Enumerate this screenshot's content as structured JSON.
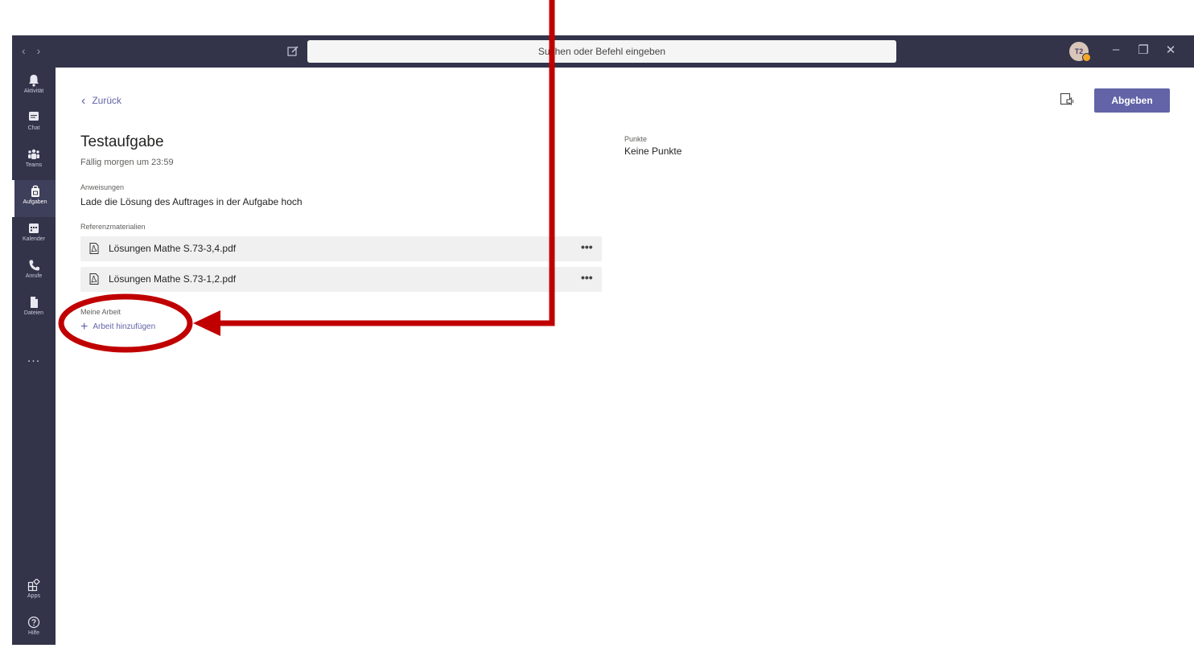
{
  "titlebar": {
    "search_placeholder": "Suchen oder Befehl eingeben",
    "avatar_initials": "T2"
  },
  "sidebar": {
    "items": [
      {
        "label": "Aktivität",
        "icon": "bell-icon"
      },
      {
        "label": "Chat",
        "icon": "chat-icon"
      },
      {
        "label": "Teams",
        "icon": "teams-icon"
      },
      {
        "label": "Aufgaben",
        "icon": "assignments-icon"
      },
      {
        "label": "Kalender",
        "icon": "calendar-icon"
      },
      {
        "label": "Anrufe",
        "icon": "phone-icon"
      },
      {
        "label": "Dateien",
        "icon": "files-icon"
      }
    ],
    "active": "Aufgaben",
    "more": "...",
    "bottom": [
      {
        "label": "Apps",
        "icon": "apps-icon"
      },
      {
        "label": "Hilfe",
        "icon": "help-icon"
      }
    ]
  },
  "header": {
    "back_label": "Zurück",
    "submit_label": "Abgeben"
  },
  "assignment": {
    "title": "Testaufgabe",
    "due": "Fällig morgen um 23:59",
    "instructions_label": "Anweisungen",
    "instructions": "Lade die Lösung des Auftrages in der Aufgabe hoch",
    "reference_label": "Referenzmaterialien",
    "files": [
      {
        "name": "Lösungen Mathe S.73-3,4.pdf"
      },
      {
        "name": "Lösungen Mathe S.73-1,2.pdf"
      }
    ],
    "my_work_label": "Meine Arbeit",
    "add_work_label": "Arbeit hinzufügen",
    "points_label": "Punkte",
    "points_value": "Keine Punkte"
  },
  "colors": {
    "rail": "#33344a",
    "accent": "#6264a7",
    "annotation": "#c00000"
  }
}
